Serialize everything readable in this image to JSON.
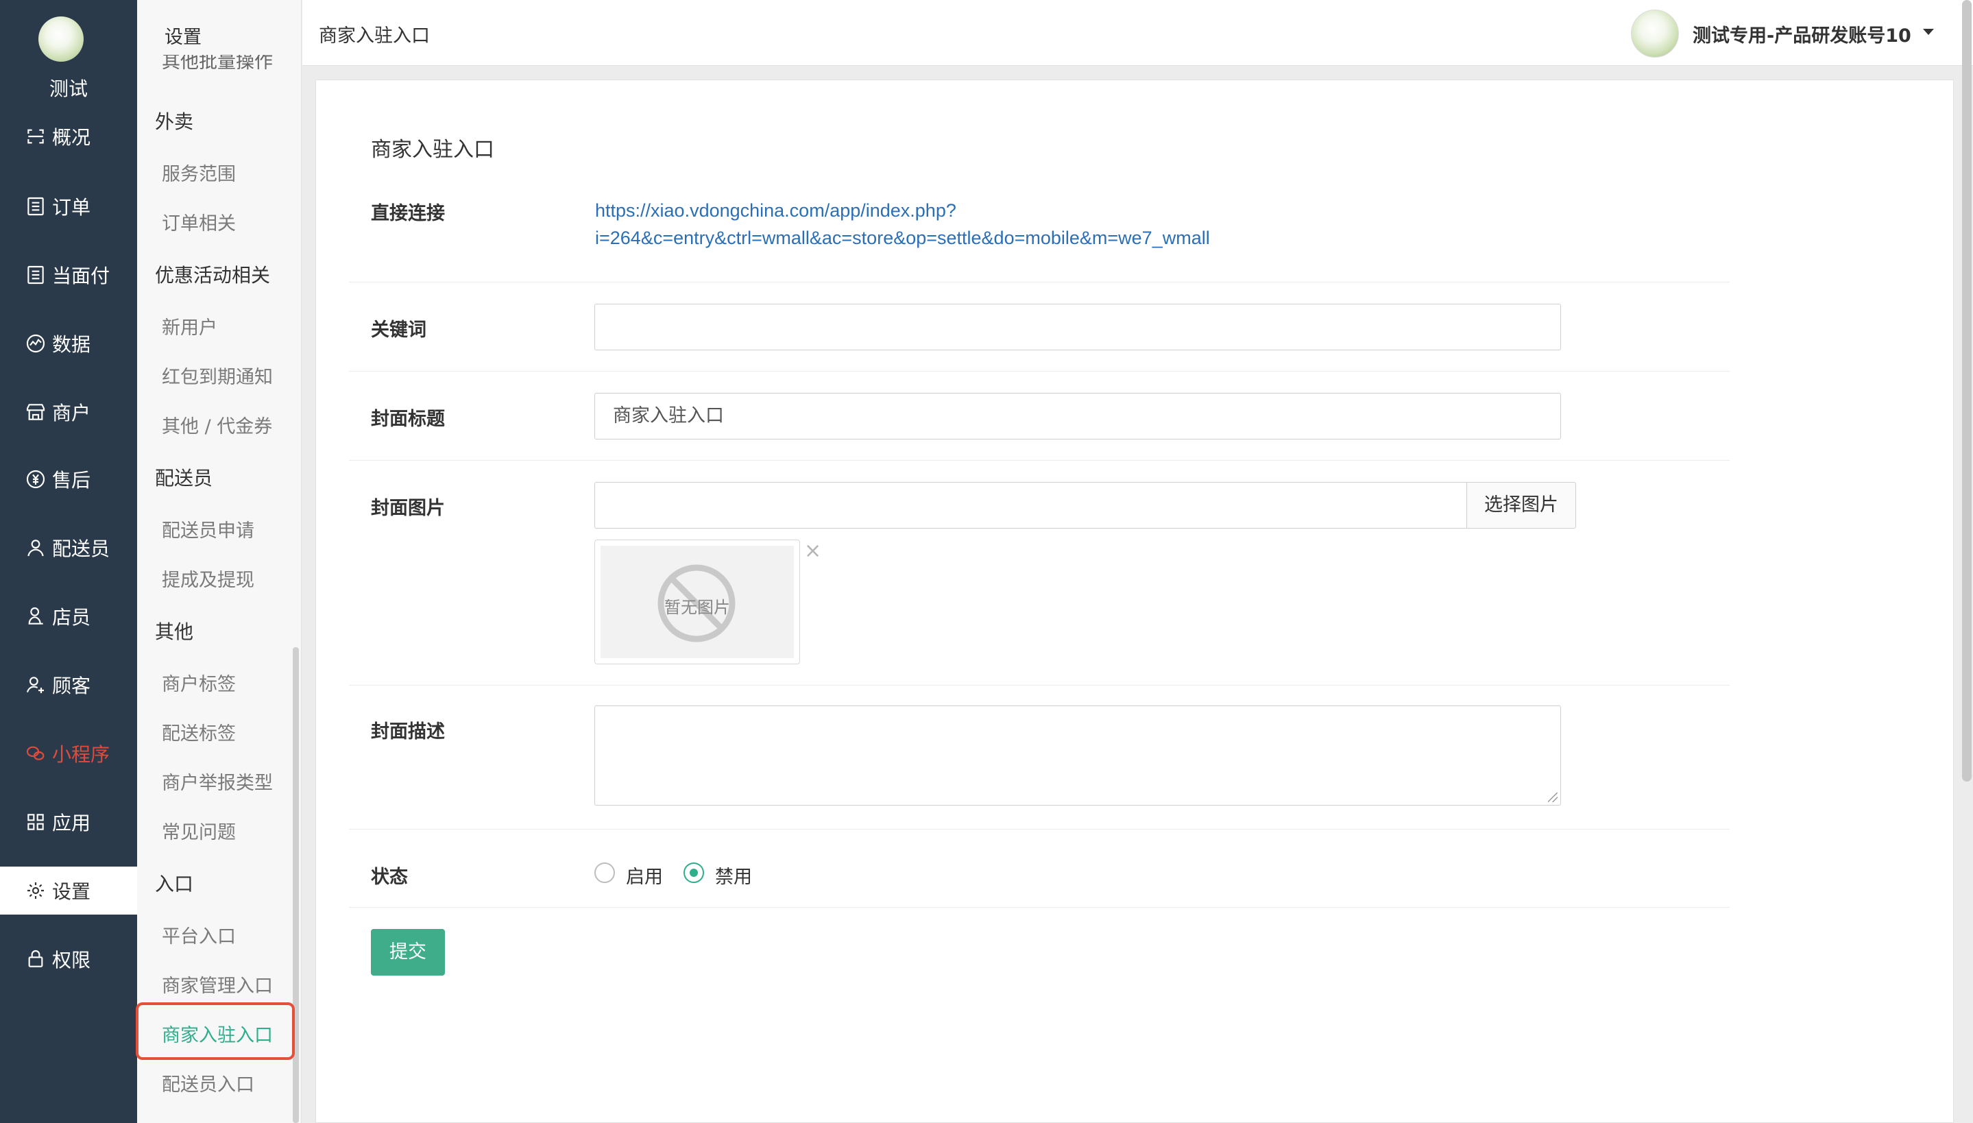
{
  "brand": {
    "name": "测试"
  },
  "nav": {
    "items": [
      {
        "key": "overview",
        "label": "概况",
        "icon": "scan-icon"
      },
      {
        "key": "orders",
        "label": "订单",
        "icon": "list-icon"
      },
      {
        "key": "facepay",
        "label": "当面付",
        "icon": "list-icon"
      },
      {
        "key": "data",
        "label": "数据",
        "icon": "chart-icon"
      },
      {
        "key": "merchant",
        "label": "商户",
        "icon": "store-icon"
      },
      {
        "key": "aftersale",
        "label": "售后",
        "icon": "yen-icon"
      },
      {
        "key": "courier",
        "label": "配送员",
        "icon": "user-icon"
      },
      {
        "key": "clerk",
        "label": "店员",
        "icon": "clerk-icon"
      },
      {
        "key": "customer",
        "label": "顾客",
        "icon": "customer-icon"
      },
      {
        "key": "miniprogram",
        "label": "小程序",
        "icon": "wechat-icon",
        "accent": "#e04b3c"
      },
      {
        "key": "apps",
        "label": "应用",
        "icon": "apps-icon"
      },
      {
        "key": "settings",
        "label": "设置",
        "icon": "gear-icon",
        "active": true
      },
      {
        "key": "permission",
        "label": "权限",
        "icon": "lock-icon"
      }
    ]
  },
  "subnav": {
    "title": "设置",
    "partial_top": "其他批量操作",
    "groups": [
      {
        "label": "外卖",
        "items": [
          "服务范围",
          "订单相关"
        ]
      },
      {
        "label": "优惠活动相关",
        "items": [
          "新用户",
          "红包到期通知",
          "其他 / 代金券"
        ]
      },
      {
        "label": "配送员",
        "items": [
          "配送员申请",
          "提成及提现"
        ]
      },
      {
        "label": "其他",
        "items": [
          "商户标签",
          "配送标签",
          "商户举报类型",
          "常见问题"
        ]
      },
      {
        "label": "入口",
        "items": [
          "平台入口",
          "商家管理入口",
          "商家入驻入口",
          "配送员入口"
        ]
      }
    ],
    "active_item": "商家入驻入口"
  },
  "topbar": {
    "breadcrumb": "商家入驻入口",
    "user_name": "测试专用-产品研发账号10"
  },
  "form": {
    "panel_title": "商家入驻入口",
    "direct_link_label": "直接连接",
    "direct_link_line1": "https://xiao.vdongchina.com/app/index.php?",
    "direct_link_line2": "i=264&c=entry&ctrl=wmall&ac=store&op=settle&do=mobile&m=we7_wmall",
    "keyword_label": "关键词",
    "keyword_value": "",
    "cover_title_label": "封面标题",
    "cover_title_value": "商家入驻入口",
    "cover_image_label": "封面图片",
    "cover_image_value": "",
    "choose_image_button": "选择图片",
    "no_image_text": "暂无图片",
    "remove_icon": "×",
    "cover_desc_label": "封面描述",
    "cover_desc_value": "",
    "status_label": "状态",
    "status_options": [
      "启用",
      "禁用"
    ],
    "status_selected": "禁用",
    "submit_button": "提交"
  },
  "colors": {
    "nav_bg": "#2b3a4a",
    "accent_green": "#2fae8c",
    "submit_green": "#3fad8a",
    "link_blue": "#2a6fb5",
    "highlight_red": "#e4513a"
  }
}
